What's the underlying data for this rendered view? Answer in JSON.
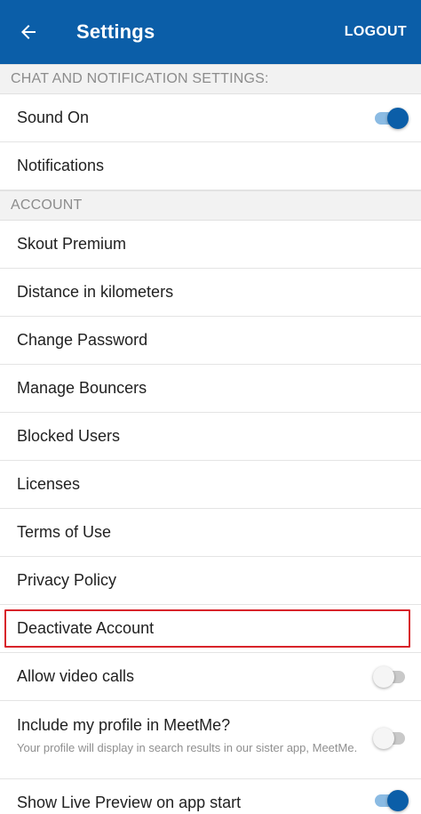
{
  "header": {
    "title": "Settings",
    "logout_label": "LOGOUT",
    "back_icon": "arrow-left-icon",
    "bg_color": "#0b5ea8"
  },
  "sections": {
    "chat": {
      "title": "CHAT AND NOTIFICATION SETTINGS:",
      "sound_on": {
        "label": "Sound On",
        "enabled": true
      },
      "notifications": {
        "label": "Notifications"
      }
    },
    "account": {
      "title": "ACCOUNT",
      "items": [
        {
          "label": "Skout Premium"
        },
        {
          "label": "Distance in kilometers"
        },
        {
          "label": "Change Password"
        },
        {
          "label": "Manage Bouncers"
        },
        {
          "label": "Blocked Users"
        },
        {
          "label": "Licenses"
        },
        {
          "label": "Terms of Use"
        },
        {
          "label": "Privacy Policy"
        }
      ],
      "deactivate": {
        "label": "Deactivate Account",
        "highlight_color": "#d8232a"
      },
      "allow_video_calls": {
        "label": "Allow video calls",
        "enabled": false
      },
      "meetme": {
        "label": "Include my profile in MeetMe?",
        "description": "Your profile will display in search results in our sister app, MeetMe.",
        "enabled": false
      },
      "live_preview": {
        "label": "Show Live Preview on app start",
        "enabled": true
      }
    }
  },
  "colors": {
    "toggle_on_thumb": "#0b5ea8",
    "toggle_on_track": "#8bbbe3",
    "toggle_off_thumb": "#f5f5f5",
    "toggle_off_track": "#c9c9c9"
  }
}
